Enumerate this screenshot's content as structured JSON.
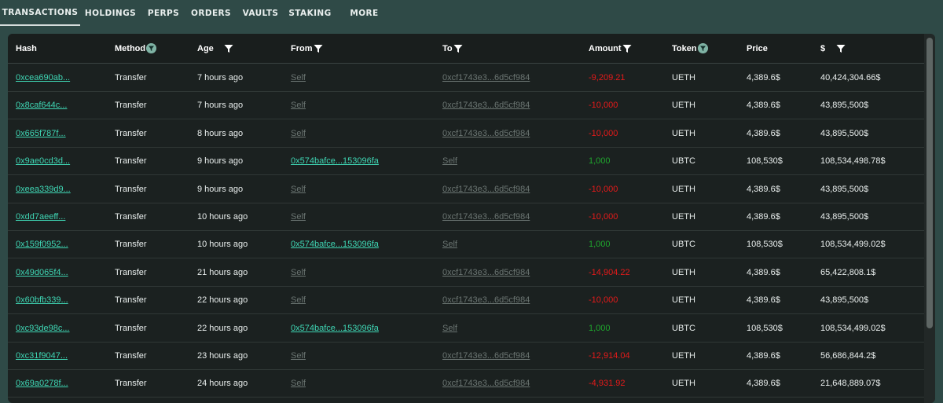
{
  "tabs": [
    {
      "label": "TRANSACTIONS",
      "active": true
    },
    {
      "label": "HOLDINGS",
      "active": false
    },
    {
      "label": "PERPS",
      "active": false
    },
    {
      "label": "ORDERS",
      "active": false
    },
    {
      "label": "VAULTS",
      "active": false
    },
    {
      "label": "STAKING",
      "active": false
    },
    {
      "label": "MORE",
      "active": false
    }
  ],
  "table": {
    "columns": {
      "hash": "Hash",
      "method": "Method",
      "age": "Age",
      "from": "From",
      "to": "To",
      "amount": "Amount",
      "token": "Token",
      "price": "Price",
      "usd": "$"
    },
    "rows": [
      {
        "hash": "0xcea690ab...",
        "method": "Transfer",
        "age": "7 hours ago",
        "from": "Self",
        "to": "0xcf1743e3...6d5cf984",
        "amount": "-9,209.21",
        "amount_sign": "neg",
        "token": "UETH",
        "price": "4,389.6$",
        "usd": "40,424,304.66$"
      },
      {
        "hash": "0x8caf644c...",
        "method": "Transfer",
        "age": "7 hours ago",
        "from": "Self",
        "to": "0xcf1743e3...6d5cf984",
        "amount": "-10,000",
        "amount_sign": "neg",
        "token": "UETH",
        "price": "4,389.6$",
        "usd": "43,895,500$"
      },
      {
        "hash": "0x665f787f...",
        "method": "Transfer",
        "age": "8 hours ago",
        "from": "Self",
        "to": "0xcf1743e3...6d5cf984",
        "amount": "-10,000",
        "amount_sign": "neg",
        "token": "UETH",
        "price": "4,389.6$",
        "usd": "43,895,500$"
      },
      {
        "hash": "0x9ae0cd3d...",
        "method": "Transfer",
        "age": "9 hours ago",
        "from": "0x574bafce...153096fa",
        "to": "Self",
        "amount": "1,000",
        "amount_sign": "pos",
        "token": "UBTC",
        "price": "108,530$",
        "usd": "108,534,498.78$"
      },
      {
        "hash": "0xeea339d9...",
        "method": "Transfer",
        "age": "9 hours ago",
        "from": "Self",
        "to": "0xcf1743e3...6d5cf984",
        "amount": "-10,000",
        "amount_sign": "neg",
        "token": "UETH",
        "price": "4,389.6$",
        "usd": "43,895,500$"
      },
      {
        "hash": "0xdd7aeeff...",
        "method": "Transfer",
        "age": "10 hours ago",
        "from": "Self",
        "to": "0xcf1743e3...6d5cf984",
        "amount": "-10,000",
        "amount_sign": "neg",
        "token": "UETH",
        "price": "4,389.6$",
        "usd": "43,895,500$"
      },
      {
        "hash": "0x159f0952...",
        "method": "Transfer",
        "age": "10 hours ago",
        "from": "0x574bafce...153096fa",
        "to": "Self",
        "amount": "1,000",
        "amount_sign": "pos",
        "token": "UBTC",
        "price": "108,530$",
        "usd": "108,534,499.02$"
      },
      {
        "hash": "0x49d065f4...",
        "method": "Transfer",
        "age": "21 hours ago",
        "from": "Self",
        "to": "0xcf1743e3...6d5cf984",
        "amount": "-14,904.22",
        "amount_sign": "neg",
        "token": "UETH",
        "price": "4,389.6$",
        "usd": "65,422,808.1$"
      },
      {
        "hash": "0x60bfb339...",
        "method": "Transfer",
        "age": "22 hours ago",
        "from": "Self",
        "to": "0xcf1743e3...6d5cf984",
        "amount": "-10,000",
        "amount_sign": "neg",
        "token": "UETH",
        "price": "4,389.6$",
        "usd": "43,895,500$"
      },
      {
        "hash": "0xc93de98c...",
        "method": "Transfer",
        "age": "22 hours ago",
        "from": "0x574bafce...153096fa",
        "to": "Self",
        "amount": "1,000",
        "amount_sign": "pos",
        "token": "UBTC",
        "price": "108,530$",
        "usd": "108,534,499.02$"
      },
      {
        "hash": "0xc31f9047...",
        "method": "Transfer",
        "age": "23 hours ago",
        "from": "Self",
        "to": "0xcf1743e3...6d5cf984",
        "amount": "-12,914.04",
        "amount_sign": "neg",
        "token": "UETH",
        "price": "4,389.6$",
        "usd": "56,686,844.2$"
      },
      {
        "hash": "0x69a0278f...",
        "method": "Transfer",
        "age": "24 hours ago",
        "from": "Self",
        "to": "0xcf1743e3...6d5cf984",
        "amount": "-4,931.92",
        "amount_sign": "neg",
        "token": "UETH",
        "price": "4,389.6$",
        "usd": "21,648,889.07$"
      }
    ]
  },
  "colors": {
    "link": "#3fd6b4",
    "negative": "#e51a1a",
    "positive": "#1fa62d",
    "muted_link": "#6b7572",
    "tab_bar": "#2f4a47",
    "table_bg": "#1b2120"
  },
  "icons": {
    "filter": "funnel-filter-icon",
    "filter_active": "funnel-filter-active-icon"
  }
}
